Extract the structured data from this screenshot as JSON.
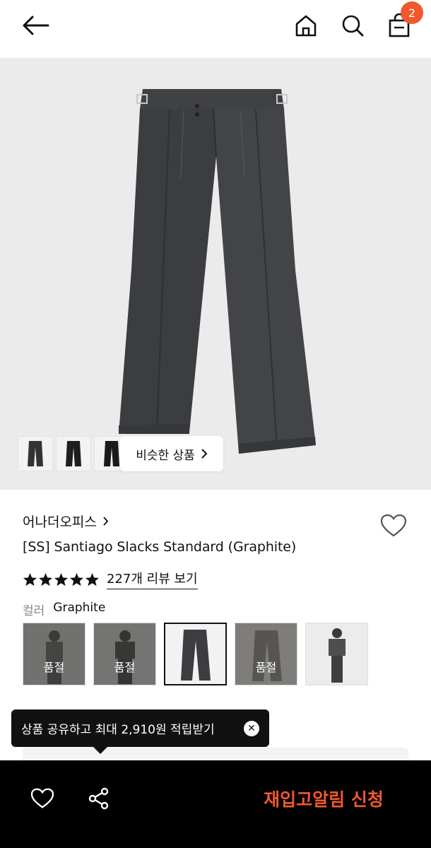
{
  "header": {
    "cart_count": "2"
  },
  "hero": {
    "similar_label": "비슷한 상품"
  },
  "product": {
    "brand": "어나더오피스",
    "title": "[SS] Santiago Slacks Standard (Graphite)",
    "rating_stars": 5,
    "review_link": "227개 리뷰 보기",
    "color_label": "컬러",
    "color_value": "Graphite",
    "swatches": [
      {
        "label": "품절",
        "sold_out": true
      },
      {
        "label": "품절",
        "sold_out": true
      },
      {
        "label": "",
        "sold_out": false,
        "selected": true
      },
      {
        "label": "품절",
        "sold_out": true
      },
      {
        "label": "",
        "sold_out": false
      }
    ]
  },
  "tooltip": {
    "text": "상품 공유하고 최대 2,910원 적립받기"
  },
  "bottom_bar": {
    "restock_label": "재입고알림 신청"
  },
  "colors": {
    "accent": "#f1582d",
    "bar": "#000000",
    "hero_bg": "#ebebeb",
    "pants": "#3e3f42"
  }
}
